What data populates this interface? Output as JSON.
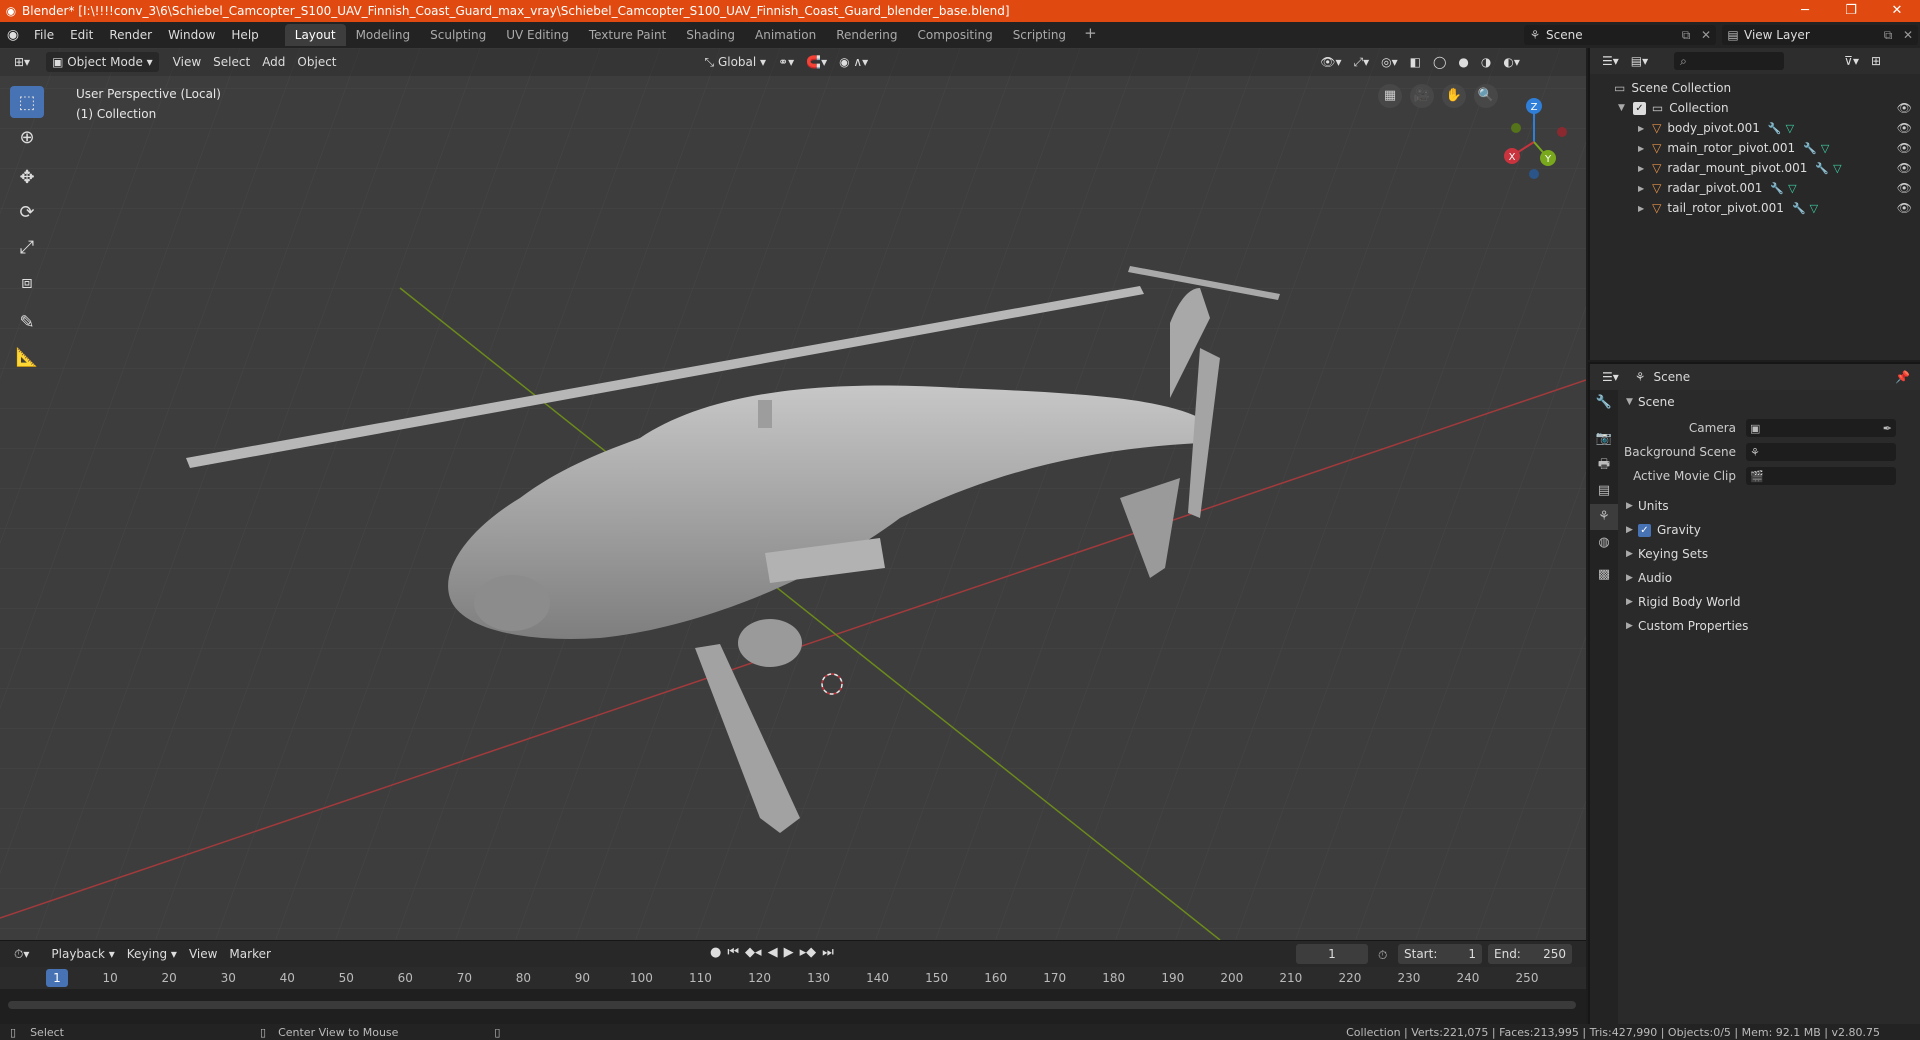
{
  "window": {
    "title": "Blender* [I:\\!!!!conv_3\\6\\Schiebel_Camcopter_S100_UAV_Finnish_Coast_Guard_max_vray\\Schiebel_Camcopter_S100_UAV_Finnish_Coast_Guard_blender_base.blend]"
  },
  "menu": [
    "File",
    "Edit",
    "Render",
    "Window",
    "Help"
  ],
  "workspaces": [
    "Layout",
    "Modeling",
    "Sculpting",
    "UV Editing",
    "Texture Paint",
    "Shading",
    "Animation",
    "Rendering",
    "Compositing",
    "Scripting"
  ],
  "active_workspace": "Layout",
  "scene_selector": "Scene",
  "view_layer_selector": "View Layer",
  "viewport": {
    "mode": "Object Mode",
    "header_menus": [
      "View",
      "Select",
      "Add",
      "Object"
    ],
    "orientation": "Global",
    "info_line1": "User Perspective (Local)",
    "info_line2": "(1) Collection",
    "gizmo_axes": {
      "x": "X",
      "y": "Y",
      "z": "Z"
    }
  },
  "colors": {
    "titlebar": "#e0490f",
    "accent": "#4772b3",
    "x_axis": "#c9333d",
    "y_axis": "#79a81d",
    "z_axis": "#2f7ed8",
    "mesh_icon": "#e8934a"
  },
  "outliner": {
    "root": "Scene Collection",
    "collection": "Collection",
    "objects": [
      "body_pivot.001",
      "main_rotor_pivot.001",
      "radar_mount_pivot.001",
      "radar_pivot.001",
      "tail_rotor_pivot.001"
    ]
  },
  "properties": {
    "header_title": "Scene",
    "section": "Scene",
    "fields": [
      {
        "label": "Camera",
        "value": ""
      },
      {
        "label": "Background Scene",
        "value": ""
      },
      {
        "label": "Active Movie Clip",
        "value": ""
      }
    ],
    "panels": [
      "Units",
      "Gravity",
      "Keying Sets",
      "Audio",
      "Rigid Body World",
      "Custom Properties"
    ],
    "gravity_checked": true
  },
  "timeline": {
    "menus": [
      "Playback",
      "Keying",
      "View",
      "Marker"
    ],
    "current_frame": "1",
    "start_label": "Start:",
    "start": "1",
    "end_label": "End:",
    "end": "250",
    "ticks": [
      "1",
      "10",
      "20",
      "30",
      "40",
      "50",
      "60",
      "70",
      "80",
      "90",
      "100",
      "110",
      "120",
      "130",
      "140",
      "150",
      "160",
      "170",
      "180",
      "190",
      "200",
      "210",
      "220",
      "230",
      "240",
      "250"
    ]
  },
  "statusbar": {
    "left": "Select",
    "middle": "Center View to Mouse",
    "right": "Collection | Verts:221,075 | Faces:213,995 | Tris:427,990 | Objects:0/5 | Mem: 92.1 MB | v2.80.75"
  }
}
